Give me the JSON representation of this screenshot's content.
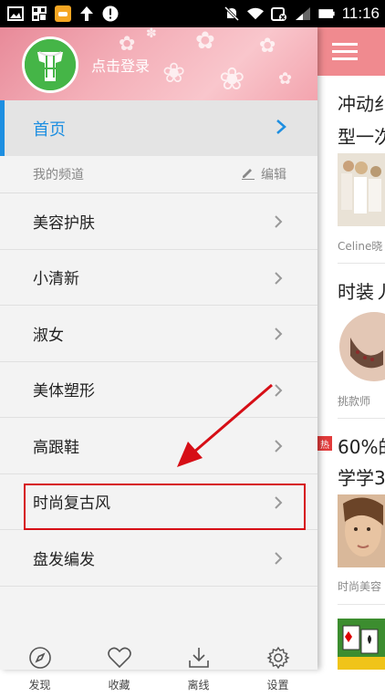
{
  "status_bar": {
    "time": "11:16",
    "icons": [
      "gallery-icon",
      "apps-icon",
      "game-icon",
      "upload-icon",
      "alert-icon",
      "mute-icon",
      "wifi-icon",
      "sim-icon",
      "signal-icon",
      "battery-icon"
    ]
  },
  "drawer": {
    "login_text": "点击登录",
    "home_label": "首页",
    "channels_label": "我的频道",
    "edit_label": "编辑",
    "channels": [
      "美容护肤",
      "小清新",
      "淑女",
      "美体塑形",
      "高跟鞋",
      "时尚复古风",
      "盘发编发"
    ],
    "bottom_nav": [
      {
        "label": "发现",
        "icon": "compass-icon"
      },
      {
        "label": "收藏",
        "icon": "heart-icon"
      },
      {
        "label": "离线",
        "icon": "download-icon"
      },
      {
        "label": "设置",
        "icon": "gear-icon"
      }
    ],
    "colors": {
      "accent": "#1e8fe1",
      "header": "#f08a8f",
      "highlight": "#d60e16"
    }
  },
  "content": {
    "articles": [
      {
        "title_line1": "冲动纟",
        "title_line2": "型一次",
        "source": "Celine晓"
      },
      {
        "title_line1": "时装丿",
        "source": "挑款师"
      },
      {
        "badge": "热",
        "title_line1": "60%的",
        "title_line2": "学学3",
        "source": "时尚美容"
      }
    ]
  }
}
